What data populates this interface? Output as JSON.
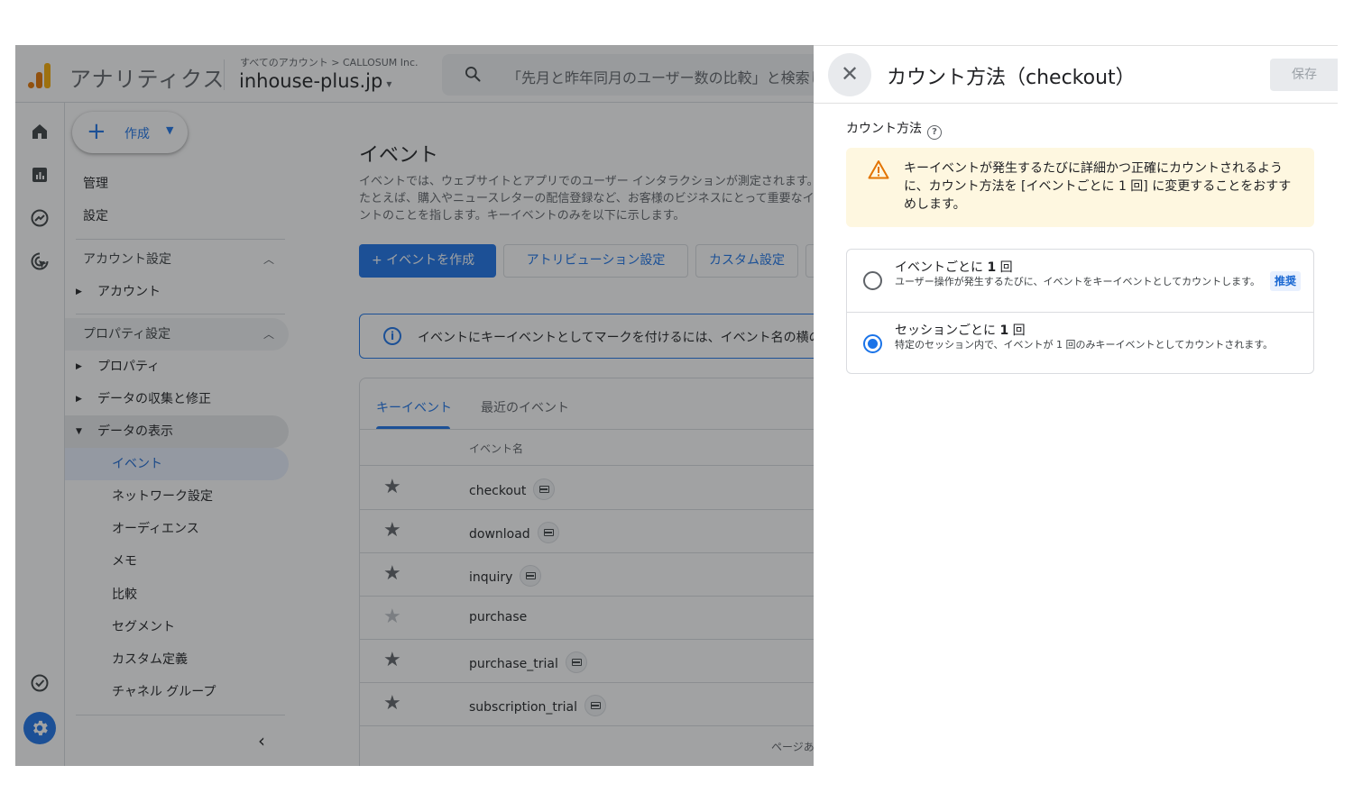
{
  "topbar": {
    "app_title": "アナリティクス",
    "breadcrumb": "すべてのアカウント > CALLOSUM Inc.",
    "property": "inhouse-plus.jp",
    "search_placeholder": "「先月と昨年同月のユーザー数の比較」と検索し"
  },
  "nav": {
    "create_label": "作成",
    "admin": "管理",
    "settings": "設定",
    "account_settings": "アカウント設定",
    "account": "アカウント",
    "property_settings": "プロパティ設定",
    "property": "プロパティ",
    "data_collection": "データの収集と修正",
    "data_display": "データの表示",
    "sub_items": [
      "イベント",
      "ネットワーク設定",
      "オーディエンス",
      "メモ",
      "比較",
      "セグメント",
      "カスタム定義",
      "チャネル グループ"
    ]
  },
  "main": {
    "heading": "イベント",
    "description": "イベントでは、ウェブサイトとアプリでのユーザー インタラクションが測定されます。たとえば、購入やニュースレターの配信登録など、お客様のビジネスにとって重要なイベントのことを指します。キーイベントのみを以下に示します。",
    "create_event_button": "+ イベントを作成",
    "attribution_button": "アトリビューション設定",
    "custom_button": "カスタム設定",
    "info_text": "イベントにキーイベントとしてマークを付けるには、イベント名の横のアイコンをクリックします。",
    "tabs": [
      "キーイベント",
      "最近のイベント"
    ],
    "column_event_name": "イベント名",
    "events": [
      {
        "name": "checkout",
        "starred": true,
        "chip": true
      },
      {
        "name": "download",
        "starred": true,
        "chip": true
      },
      {
        "name": "inquiry",
        "starred": true,
        "chip": true
      },
      {
        "name": "purchase",
        "starred": false,
        "chip": false
      },
      {
        "name": "purchase_trial",
        "starred": true,
        "chip": true
      },
      {
        "name": "subscription_trial",
        "starred": true,
        "chip": true
      }
    ],
    "pager_text": "ページあたりの行数"
  },
  "panel": {
    "title": "カウント方法（checkout）",
    "save_label": "保存",
    "section_label": "カウント方法",
    "warning": "キーイベントが発生するたびに詳細かつ正確にカウントされるように、カウント方法を [イベントごとに 1 回] に変更することをおすすめします。",
    "options": [
      {
        "title_prefix": "イベントごとに ",
        "title_bold": "1",
        "title_suffix": " 回",
        "description": "ユーザー操作が発生するたびに、イベントをキーイベントとしてカウントします。",
        "badge": "推奨",
        "selected": false
      },
      {
        "title_prefix": "セッションごとに ",
        "title_bold": "1",
        "title_suffix": " 回",
        "description": "特定のセッション内で、イベントが 1 回のみキーイベントとしてカウントされます。",
        "badge": "",
        "selected": true
      }
    ]
  },
  "colors": {
    "accent": "#1a73e8",
    "warning_bg": "#fef7e0",
    "warning_icon": "#e37400",
    "scrim": "rgba(32,33,36,0.42)"
  }
}
